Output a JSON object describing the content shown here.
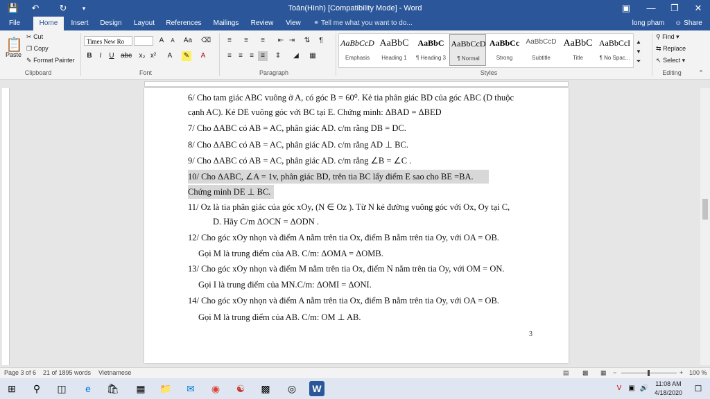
{
  "window": {
    "title": "Toán(Hình) [Compatibility Mode] - Word",
    "user": "long pham",
    "share_label": "Share"
  },
  "quick_access": {
    "save_icon": "save-icon",
    "undo_icon": "undo-icon",
    "redo_icon": "redo-icon",
    "customize_icon": "customize-icon"
  },
  "tabs": [
    "File",
    "Home",
    "Insert",
    "Design",
    "Layout",
    "References",
    "Mailings",
    "Review",
    "View"
  ],
  "tell_me": "Tell me what you want to do...",
  "ribbon": {
    "clipboard": {
      "paste": "Paste",
      "cut": "Cut",
      "copy": "Copy",
      "format_painter": "Format Painter",
      "label": "Clipboard"
    },
    "font": {
      "name": "Times New Ro",
      "size": "",
      "label": "Font"
    },
    "paragraph": {
      "label": "Paragraph"
    },
    "styles": {
      "label": "Styles",
      "items": [
        {
          "preview": "AaBbCcD",
          "name": "Emphasis"
        },
        {
          "preview": "AaBbC",
          "name": "Heading 1"
        },
        {
          "preview": "AaBbC",
          "name": "¶ Heading 3"
        },
        {
          "preview": "AaBbCcD",
          "name": "¶ Normal"
        },
        {
          "preview": "AaBbCc",
          "name": "Strong"
        },
        {
          "preview": "AaBbCcD",
          "name": "Subtitle"
        },
        {
          "preview": "AaBbC",
          "name": "Title"
        },
        {
          "preview": "AaBbCcI",
          "name": "¶ No Spac..."
        }
      ]
    },
    "editing": {
      "find": "Find",
      "replace": "Replace",
      "select": "Select",
      "label": "Editing"
    }
  },
  "document": {
    "lines": [
      "6/ Cho tam giác ABC vuông ở A, có góc B = 60⁰. Kẻ tia phân giác BD của góc ABC (D thuộc",
      "cạnh AC). Kẻ DE vuông góc với BC tại E. Chứng minh:  ΔBAD =  ΔBED",
      "7/ Cho  ΔABC  có AB = AC, phân giác AD. c/m rằng DB = DC.",
      "8/ Cho  ΔABC  có AB = AC, phân giác AD. c/m rằng AD ⊥ BC.",
      "9/ Cho  ΔABC  có AB = AC, phân giác AD. c/m rằng   ∠B = ∠C .",
      "10/ Cho  ΔABC, ∠A = 1v, phân giác BD, trên tia BC lấy điểm E sao cho BE =BA.",
      "Chứng minh  DE ⊥ BC.",
      "11/ Oz là tia phân giác của  góc xOy, (N ∈ Oz ). Từ N kẻ đường vuông góc với Ox, Oy tại C,",
      "D. Hãy C/m ΔOCN = ΔODN .",
      "12/ Cho góc xOy nhọn và điểm A nằm trên tia Ox, điểm B nằm trên tia Oy, với OA = OB.",
      "Gọi M là trung điểm của AB. C/m:  ΔOMA =  ΔOMB.",
      "13/ Cho góc xOy nhọn và điểm M nằm trên tia Ox, điểm N nằm trên tia Oy, với OM = ON.",
      "Gọi I là trung điểm của MN.C/m:  ΔOMI =  ΔONI.",
      "14/ Cho góc xOy nhọn và điểm A nằm trên tia Ox, điểm B nằm trên tia Oy, với OA = OB.",
      "Gọi M là trung điểm của AB. C/m: OM   ⊥ AB."
    ],
    "page_number": "3"
  },
  "status": {
    "page": "Page 3 of 6",
    "words": "21 of 1895 words",
    "language": "Vietnamese",
    "zoom": "100 %"
  },
  "taskbar": {
    "time": "11:08 AM",
    "date": "4/18/2020"
  }
}
